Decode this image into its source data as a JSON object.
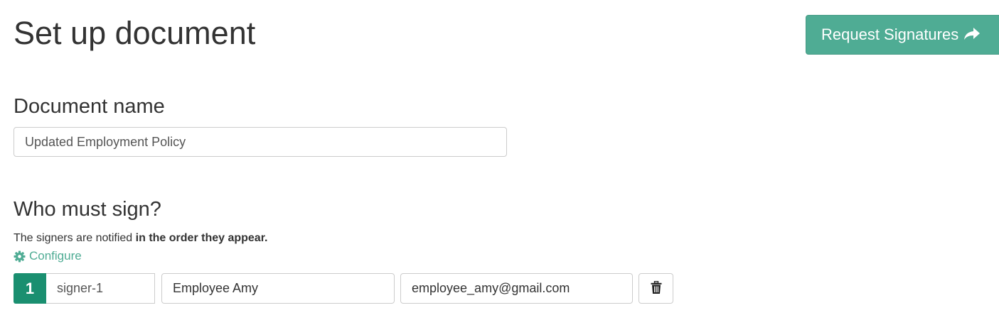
{
  "header": {
    "title": "Set up document",
    "request_button_label": "Request Signatures",
    "request_button_icon": "share-icon"
  },
  "document": {
    "section_title": "Document name",
    "name_value": "Updated Employment Policy"
  },
  "signers_section": {
    "title": "Who must sign?",
    "notice_prefix": "The signers are notified ",
    "notice_emphasis": "in the order they appear.",
    "configure_label": "Configure",
    "configure_icon": "gear-icon"
  },
  "signers": [
    {
      "order": "1",
      "role": "signer-1",
      "name": "Employee Amy",
      "email": "employee_amy@gmail.com",
      "delete_icon": "trash-icon"
    }
  ],
  "colors": {
    "accent": "#4fac94",
    "order_badge": "#1a8f70",
    "text": "#333333"
  }
}
